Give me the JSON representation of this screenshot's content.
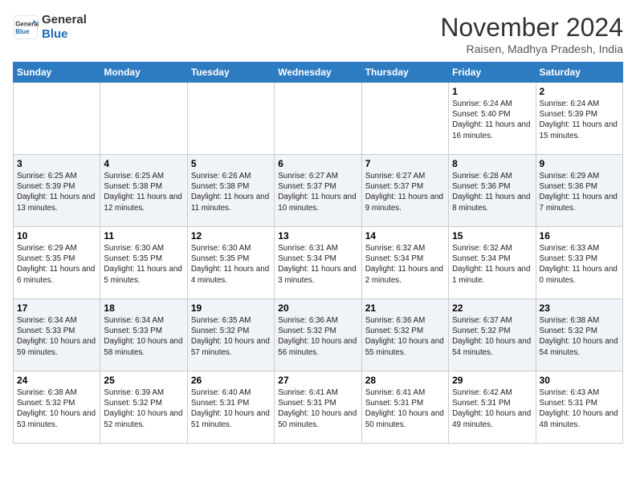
{
  "header": {
    "logo_line1": "General",
    "logo_line2": "Blue",
    "month": "November 2024",
    "location": "Raisen, Madhya Pradesh, India"
  },
  "weekdays": [
    "Sunday",
    "Monday",
    "Tuesday",
    "Wednesday",
    "Thursday",
    "Friday",
    "Saturday"
  ],
  "weeks": [
    [
      {
        "day": "",
        "text": ""
      },
      {
        "day": "",
        "text": ""
      },
      {
        "day": "",
        "text": ""
      },
      {
        "day": "",
        "text": ""
      },
      {
        "day": "",
        "text": ""
      },
      {
        "day": "1",
        "text": "Sunrise: 6:24 AM\nSunset: 5:40 PM\nDaylight: 11 hours and 16 minutes."
      },
      {
        "day": "2",
        "text": "Sunrise: 6:24 AM\nSunset: 5:39 PM\nDaylight: 11 hours and 15 minutes."
      }
    ],
    [
      {
        "day": "3",
        "text": "Sunrise: 6:25 AM\nSunset: 5:39 PM\nDaylight: 11 hours and 13 minutes."
      },
      {
        "day": "4",
        "text": "Sunrise: 6:25 AM\nSunset: 5:38 PM\nDaylight: 11 hours and 12 minutes."
      },
      {
        "day": "5",
        "text": "Sunrise: 6:26 AM\nSunset: 5:38 PM\nDaylight: 11 hours and 11 minutes."
      },
      {
        "day": "6",
        "text": "Sunrise: 6:27 AM\nSunset: 5:37 PM\nDaylight: 11 hours and 10 minutes."
      },
      {
        "day": "7",
        "text": "Sunrise: 6:27 AM\nSunset: 5:37 PM\nDaylight: 11 hours and 9 minutes."
      },
      {
        "day": "8",
        "text": "Sunrise: 6:28 AM\nSunset: 5:36 PM\nDaylight: 11 hours and 8 minutes."
      },
      {
        "day": "9",
        "text": "Sunrise: 6:29 AM\nSunset: 5:36 PM\nDaylight: 11 hours and 7 minutes."
      }
    ],
    [
      {
        "day": "10",
        "text": "Sunrise: 6:29 AM\nSunset: 5:35 PM\nDaylight: 11 hours and 6 minutes."
      },
      {
        "day": "11",
        "text": "Sunrise: 6:30 AM\nSunset: 5:35 PM\nDaylight: 11 hours and 5 minutes."
      },
      {
        "day": "12",
        "text": "Sunrise: 6:30 AM\nSunset: 5:35 PM\nDaylight: 11 hours and 4 minutes."
      },
      {
        "day": "13",
        "text": "Sunrise: 6:31 AM\nSunset: 5:34 PM\nDaylight: 11 hours and 3 minutes."
      },
      {
        "day": "14",
        "text": "Sunrise: 6:32 AM\nSunset: 5:34 PM\nDaylight: 11 hours and 2 minutes."
      },
      {
        "day": "15",
        "text": "Sunrise: 6:32 AM\nSunset: 5:34 PM\nDaylight: 11 hours and 1 minute."
      },
      {
        "day": "16",
        "text": "Sunrise: 6:33 AM\nSunset: 5:33 PM\nDaylight: 11 hours and 0 minutes."
      }
    ],
    [
      {
        "day": "17",
        "text": "Sunrise: 6:34 AM\nSunset: 5:33 PM\nDaylight: 10 hours and 59 minutes."
      },
      {
        "day": "18",
        "text": "Sunrise: 6:34 AM\nSunset: 5:33 PM\nDaylight: 10 hours and 58 minutes."
      },
      {
        "day": "19",
        "text": "Sunrise: 6:35 AM\nSunset: 5:32 PM\nDaylight: 10 hours and 57 minutes."
      },
      {
        "day": "20",
        "text": "Sunrise: 6:36 AM\nSunset: 5:32 PM\nDaylight: 10 hours and 56 minutes."
      },
      {
        "day": "21",
        "text": "Sunrise: 6:36 AM\nSunset: 5:32 PM\nDaylight: 10 hours and 55 minutes."
      },
      {
        "day": "22",
        "text": "Sunrise: 6:37 AM\nSunset: 5:32 PM\nDaylight: 10 hours and 54 minutes."
      },
      {
        "day": "23",
        "text": "Sunrise: 6:38 AM\nSunset: 5:32 PM\nDaylight: 10 hours and 54 minutes."
      }
    ],
    [
      {
        "day": "24",
        "text": "Sunrise: 6:38 AM\nSunset: 5:32 PM\nDaylight: 10 hours and 53 minutes."
      },
      {
        "day": "25",
        "text": "Sunrise: 6:39 AM\nSunset: 5:32 PM\nDaylight: 10 hours and 52 minutes."
      },
      {
        "day": "26",
        "text": "Sunrise: 6:40 AM\nSunset: 5:31 PM\nDaylight: 10 hours and 51 minutes."
      },
      {
        "day": "27",
        "text": "Sunrise: 6:41 AM\nSunset: 5:31 PM\nDaylight: 10 hours and 50 minutes."
      },
      {
        "day": "28",
        "text": "Sunrise: 6:41 AM\nSunset: 5:31 PM\nDaylight: 10 hours and 50 minutes."
      },
      {
        "day": "29",
        "text": "Sunrise: 6:42 AM\nSunset: 5:31 PM\nDaylight: 10 hours and 49 minutes."
      },
      {
        "day": "30",
        "text": "Sunrise: 6:43 AM\nSunset: 5:31 PM\nDaylight: 10 hours and 48 minutes."
      }
    ]
  ]
}
